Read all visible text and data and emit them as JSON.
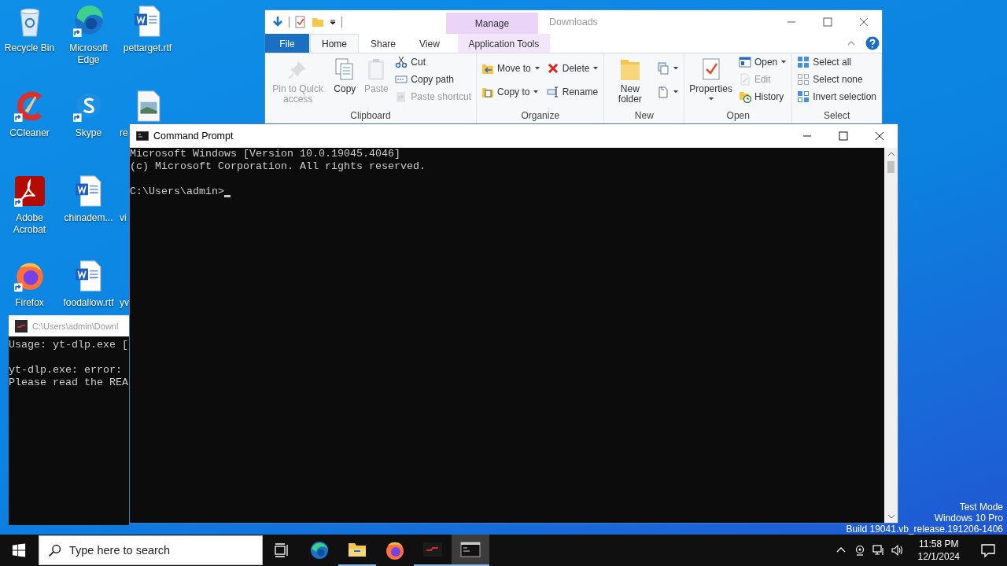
{
  "desktop": {
    "icons": [
      {
        "label": "Recycle Bin"
      },
      {
        "label": "Microsoft Edge"
      },
      {
        "label": "pettarget.rtf"
      },
      {
        "label": "CCleaner"
      },
      {
        "label": "Skype"
      },
      {
        "label": "re"
      },
      {
        "label": "Adobe Acrobat"
      },
      {
        "label": "chinadem..."
      },
      {
        "label": "vi"
      },
      {
        "label": "Firefox"
      },
      {
        "label": "foodallow.rtf"
      },
      {
        "label": "yv"
      }
    ],
    "system_notice": [
      "Test Mode",
      "Windows 10 Pro",
      "Build 19041.vb_release.191206-1406"
    ]
  },
  "explorer": {
    "title": "Downloads",
    "context_tab": "Manage",
    "tabs": [
      {
        "label": "File",
        "kind": "file",
        "selected": false
      },
      {
        "label": "Home",
        "kind": "tab",
        "selected": true
      },
      {
        "label": "Share",
        "kind": "tab",
        "selected": false
      },
      {
        "label": "View",
        "kind": "tab",
        "selected": false
      },
      {
        "label": "Application Tools",
        "kind": "context",
        "selected": false
      }
    ],
    "groups": [
      {
        "label": "Clipboard",
        "columns": [
          [
            {
              "label": "Pin to Quick access",
              "kind": "large",
              "disabled": true,
              "menu": false
            }
          ],
          [
            {
              "label": "Copy",
              "kind": "large",
              "disabled": false,
              "menu": false
            }
          ],
          [
            {
              "label": "Paste",
              "kind": "large",
              "disabled": true,
              "menu": false
            }
          ],
          [
            {
              "label": "Cut",
              "kind": "small",
              "disabled": false,
              "menu": false
            },
            {
              "label": "Copy path",
              "kind": "small",
              "disabled": false,
              "menu": false
            },
            {
              "label": "Paste shortcut",
              "kind": "small",
              "disabled": true,
              "menu": false
            }
          ]
        ]
      },
      {
        "label": "Organize",
        "columns": [
          [
            {
              "label": "Move to",
              "kind": "small",
              "disabled": false,
              "menu": true
            },
            {
              "label": "Copy to",
              "kind": "small",
              "disabled": false,
              "menu": true
            }
          ],
          [
            {
              "label": "Delete",
              "kind": "small",
              "disabled": false,
              "menu": true
            },
            {
              "label": "Rename",
              "kind": "small",
              "disabled": false,
              "menu": false
            }
          ]
        ]
      },
      {
        "label": "New",
        "columns": [
          [
            {
              "label": "New folder",
              "kind": "large",
              "disabled": false,
              "menu": false
            }
          ],
          [
            {
              "kind": "small",
              "disabled": false,
              "menu": true
            },
            {
              "kind": "small",
              "disabled": false,
              "menu": true
            }
          ]
        ]
      },
      {
        "label": "Open",
        "columns": [
          [
            {
              "label": "Properties",
              "kind": "large",
              "disabled": false,
              "menu": true
            }
          ],
          [
            {
              "label": "Open",
              "kind": "small",
              "disabled": false,
              "menu": true
            },
            {
              "label": "Edit",
              "kind": "small",
              "disabled": true,
              "menu": false
            },
            {
              "label": "History",
              "kind": "small",
              "disabled": false,
              "menu": false
            }
          ]
        ]
      },
      {
        "label": "Select",
        "columns": [
          [
            {
              "label": "Select all",
              "kind": "small",
              "disabled": false,
              "menu": false
            },
            {
              "label": "Select none",
              "kind": "small",
              "disabled": false,
              "menu": false
            },
            {
              "label": "Invert selection",
              "kind": "small",
              "disabled": false,
              "menu": false
            }
          ]
        ]
      }
    ]
  },
  "console": {
    "title": "C:\\Users\\admin\\Downl",
    "blocks": [
      [
        "Usage: yt-dlp.exe ["
      ],
      [
        "yt-dlp.exe: error:",
        "Please read the REA"
      ]
    ]
  },
  "command_prompt": {
    "title": "Command Prompt",
    "blocks": [
      [
        "Microsoft Windows [Version 10.0.19045.4046]",
        "(c) Microsoft Corporation. All rights reserved."
      ],
      [
        "C:\\Users\\admin>"
      ]
    ]
  },
  "taskbar": {
    "search": {
      "placeholder": "Type here to search"
    },
    "apps": [
      {
        "running": false,
        "selected": false
      },
      {
        "running": true,
        "selected": false
      },
      {
        "running": false,
        "selected": false
      },
      {
        "running": true,
        "selected": false
      },
      {
        "running": true,
        "selected": true
      }
    ],
    "clock": {
      "time": "11:58 PM",
      "date": "12/1/2024"
    }
  }
}
